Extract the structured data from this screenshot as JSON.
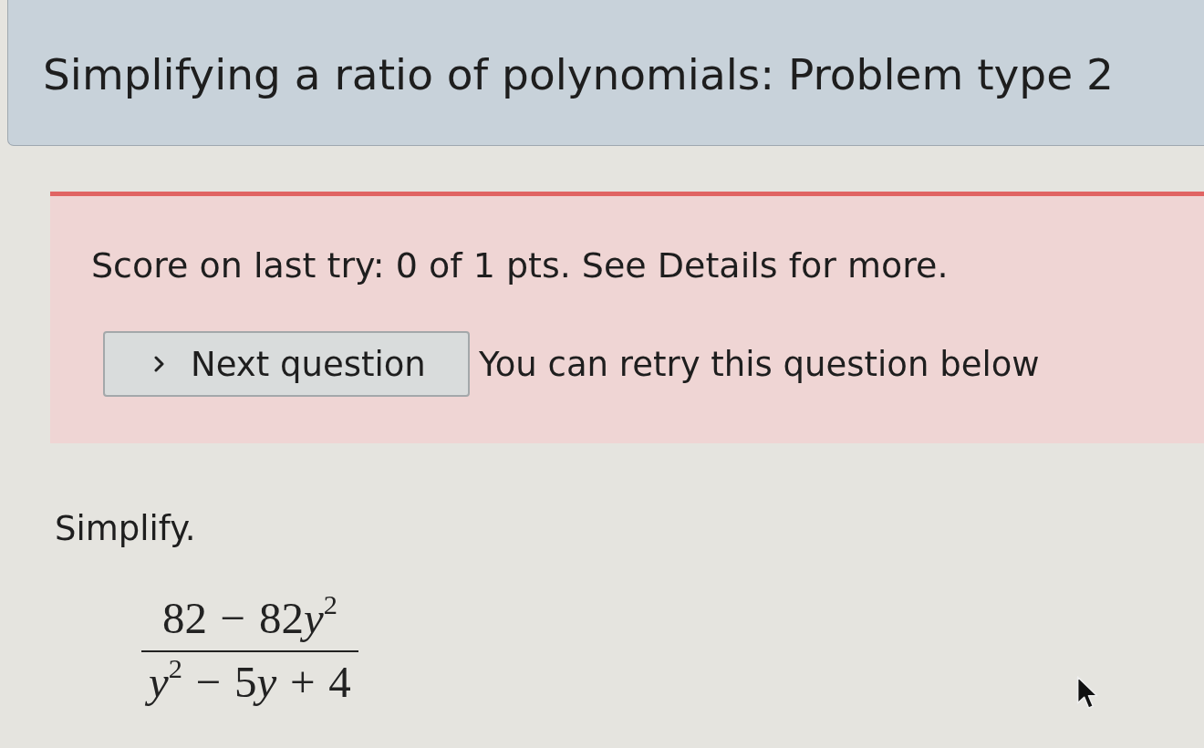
{
  "header": {
    "title": "Simplifying a ratio of polynomials: Problem type 2"
  },
  "alert": {
    "score_text": "Score on last try: 0 of 1 pts. See Details for more.",
    "next_button": {
      "label": "Next question"
    },
    "retry_note": "You can retry this question below"
  },
  "question": {
    "prompt": "Simplify.",
    "expression": {
      "numerator": [
        {
          "kind": "number",
          "text": "82"
        },
        {
          "kind": "operator",
          "text": "−"
        },
        {
          "kind": "number",
          "text": "82"
        },
        {
          "kind": "variable",
          "text": "y",
          "exponent": "2"
        }
      ],
      "denominator": [
        {
          "kind": "variable",
          "text": "y",
          "exponent": "2"
        },
        {
          "kind": "operator",
          "text": "−"
        },
        {
          "kind": "number",
          "text": "5"
        },
        {
          "kind": "variable",
          "text": "y"
        },
        {
          "kind": "operator",
          "text": "+"
        },
        {
          "kind": "number",
          "text": "4"
        }
      ]
    }
  }
}
